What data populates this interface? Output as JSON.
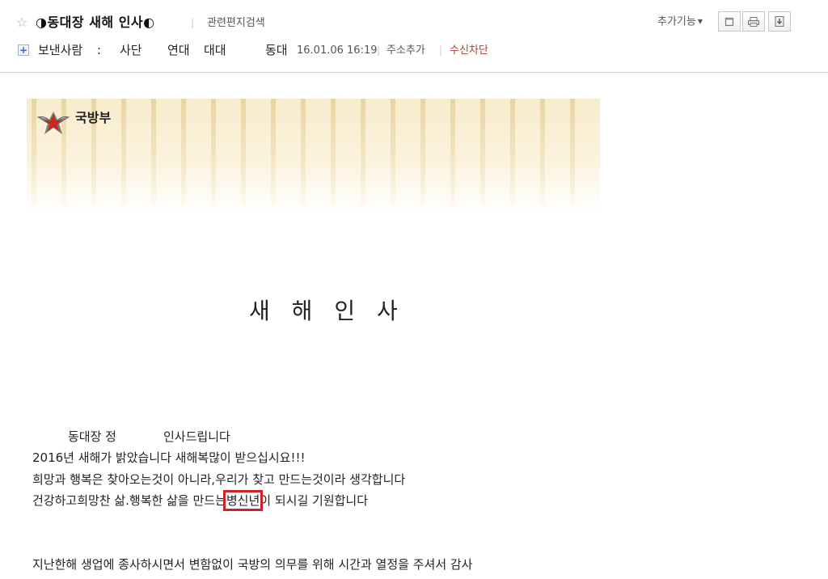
{
  "header": {
    "subject": "◑동대장 새해 인사◐",
    "related_search": "관련편지검색",
    "more_functions": "추가기능"
  },
  "sender": {
    "label": "보낸사람",
    "colon": ":",
    "parts": [
      "사단",
      "연대",
      "대대",
      "동대"
    ],
    "datetime": "16.01.06 16:19",
    "add_address": "주소추가",
    "block_sender": "수신차단"
  },
  "banner": {
    "brand": "국방부"
  },
  "body": {
    "heading": "새 해 인 사",
    "line1_a": "동대장 정",
    "line1_b": "인사드립니다",
    "line2": "2016년 새해가 밝았습니다  새해복많이 받으십시요!!!",
    "line3": "희망과 행복은 찾아오는것이 아니라,우리가 찾고 만드는것이라 생각합니다",
    "line4_before": "건강하고희망찬 삶.행복한 삶을 만드는",
    "line4_highlight": "병신년",
    "line4_after": "이 되시길 기원합니다",
    "line5": "지난한해 생업에 종사하시면서  변함없이 국방의 의무를  위해 시간과 열정을 주셔서 감사"
  },
  "icons": {
    "star": "star-outline-icon",
    "expand": "plus-box-icon",
    "window": "new-window-icon",
    "print": "printer-icon",
    "save": "download-icon",
    "logo": "mnd-emblem-icon"
  },
  "colors": {
    "block_link": "#b34030",
    "highlight_box": "#d0202a",
    "banner_bg": "#f8eccd"
  }
}
